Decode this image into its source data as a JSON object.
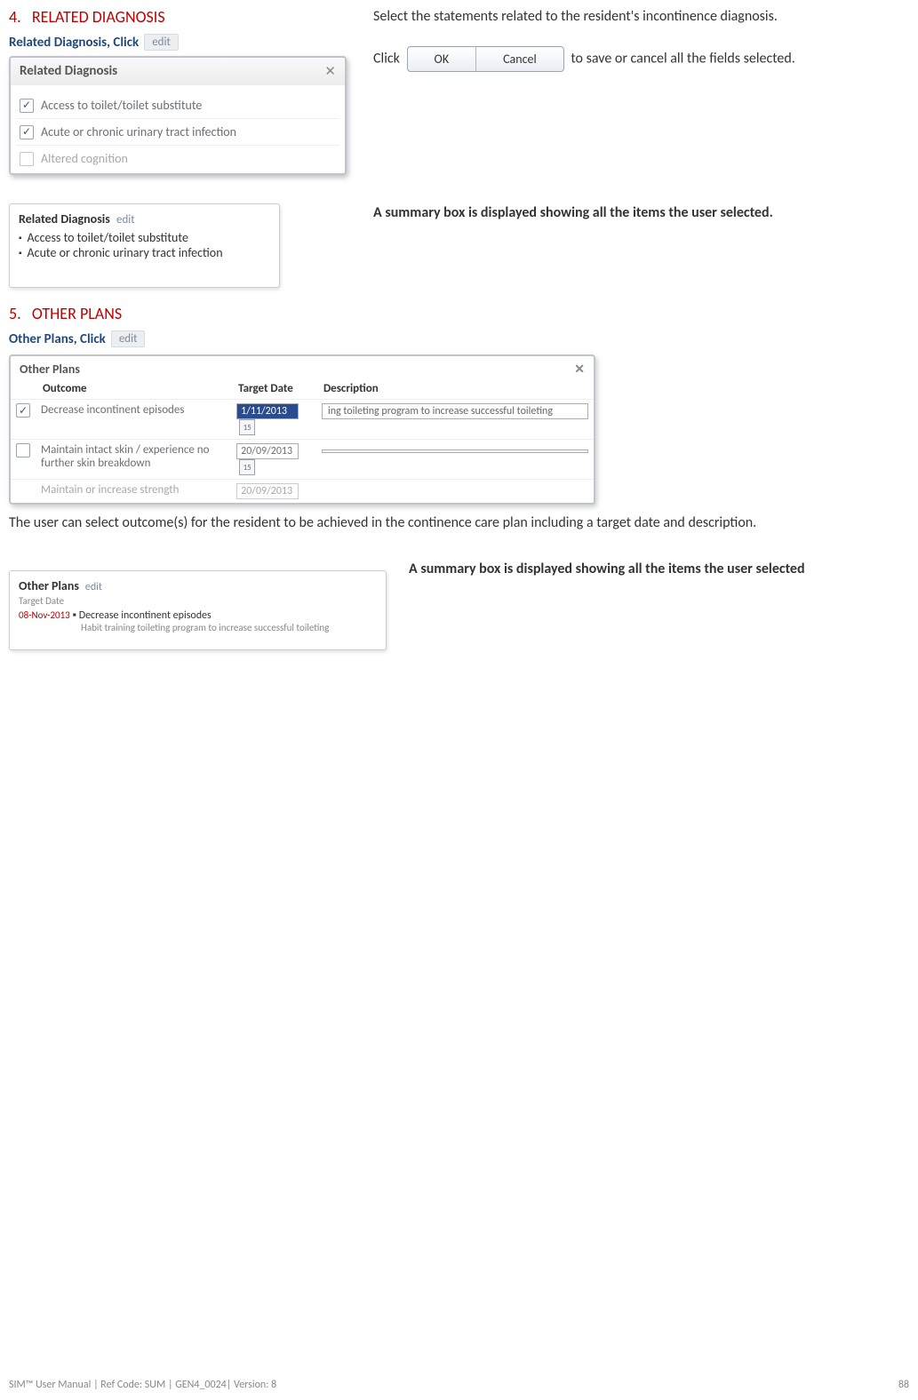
{
  "section4": {
    "heading_num": "4.",
    "heading_text": "RELATED DIAGNOSIS",
    "subhead": "Related Diagnosis, Click",
    "edit_label": "edit",
    "dialog": {
      "title": "Related Diagnosis",
      "close": "✕",
      "items": [
        {
          "label": "Access to toilet/toilet substitute",
          "checked": true
        },
        {
          "label": "Acute or chronic urinary tract infection",
          "checked": true
        },
        {
          "label": "Altered cognition",
          "checked": false
        }
      ]
    },
    "summary": {
      "title": "Related Diagnosis",
      "edit": "edit",
      "items": [
        "Access to toilet/toilet substitute",
        "Acute or chronic urinary tract infection"
      ]
    },
    "right1": "Select the statements related to the resident's incontinence diagnosis.",
    "click_word": "Click",
    "ok_label": "OK",
    "cancel_label": "Cancel",
    "right2_tail": " to save or cancel all the fields selected.",
    "right3": "A summary box is displayed showing all the items the user selected."
  },
  "section5": {
    "heading_num": "5.",
    "heading_text": "OTHER PLANS",
    "subhead": "Other Plans, Click",
    "edit_label": "edit",
    "dialog": {
      "title": "Other Plans",
      "close": "✕",
      "columns": {
        "outcome": "Outcome",
        "target": "Target Date",
        "desc": "Description"
      },
      "rows": [
        {
          "checked": true,
          "outcome": "Decrease incontinent episodes",
          "date": "1/11/2013",
          "date_hl": true,
          "desc": "ing toileting program to increase successful toileting"
        },
        {
          "checked": false,
          "outcome": "Maintain intact skin / experience no further skin breakdown",
          "date": "20/09/2013",
          "date_hl": false,
          "desc": ""
        },
        {
          "checked": false,
          "outcome": "Maintain or increase strength",
          "date": "20/09/2013",
          "date_hl": false,
          "desc": ""
        }
      ]
    },
    "para": "The user can select outcome(s) for the resident to be achieved in the continence care plan including a target date and description.",
    "summary": {
      "title": "Other Plans",
      "edit": "edit",
      "sublabel": "Target Date",
      "date": "08-Nov-2013",
      "bullet_point": "Decrease incontinent episodes",
      "desc": "Habit training toileting program to increase successful toileting"
    },
    "right_text": "A summary box is displayed showing all the items the user selected"
  },
  "footer": {
    "left": "SIM™ User Manual | Ref Code: SUM | GEN4_0024| Version: 8",
    "right": "88"
  }
}
